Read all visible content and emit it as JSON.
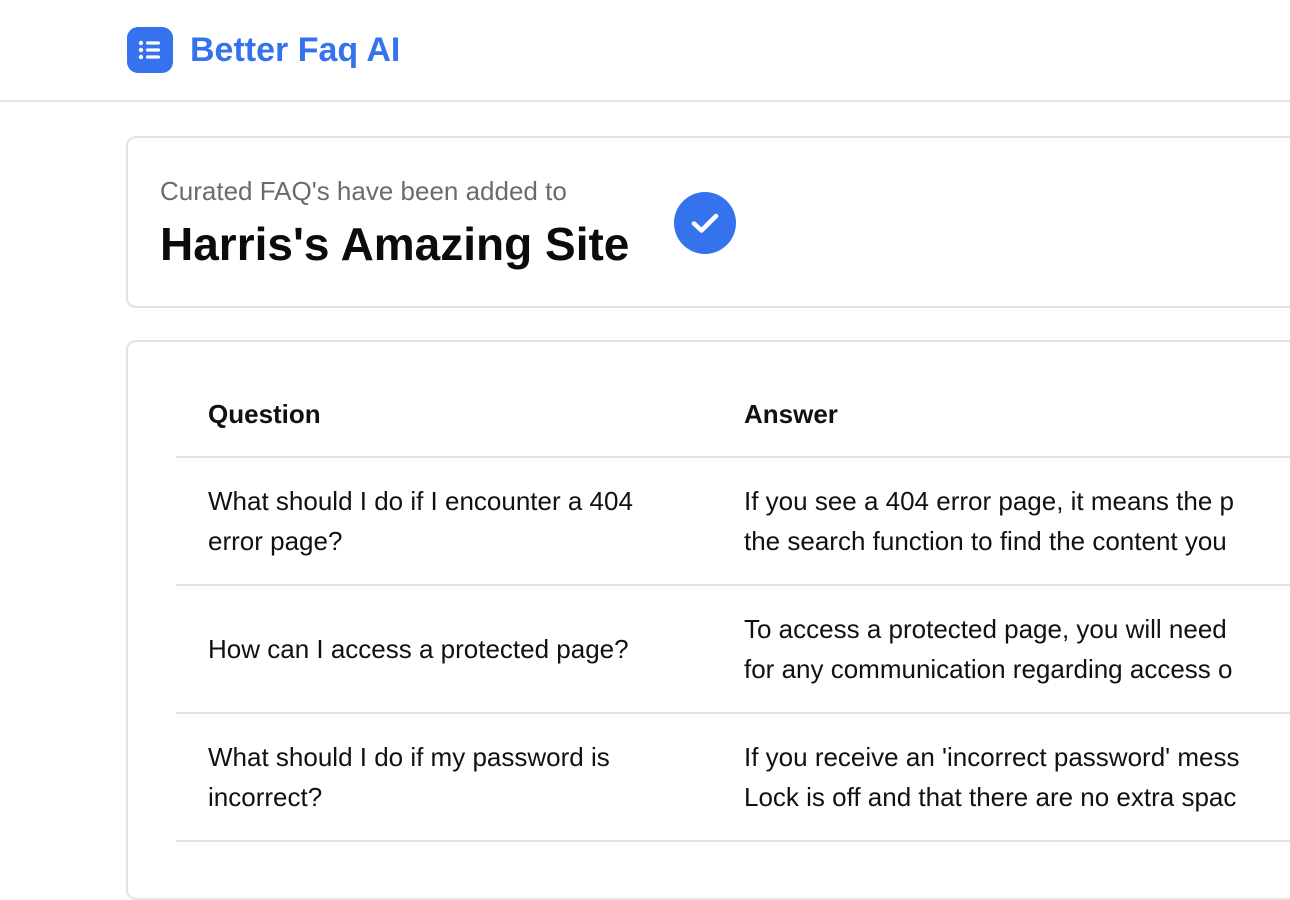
{
  "app": {
    "name": "Better Faq AI",
    "logo_icon": "list-icon",
    "accent_color": "#3472ee"
  },
  "status": {
    "caption": "Curated FAQ's have been added to",
    "site_name": "Harris's Amazing Site",
    "icon": "check-circle-icon"
  },
  "table": {
    "headers": {
      "question": "Question",
      "answer": "Answer"
    },
    "rows": [
      {
        "question": "What should I do if I encounter a 404 error page?",
        "answer_line1": "If you see a 404 error page, it means the p",
        "answer_line2": "the search function to find the content you"
      },
      {
        "question": "How can I access a protected page?",
        "answer_line1": "To access a protected page, you will need",
        "answer_line2": "for any communication regarding access o"
      },
      {
        "question": "What should I do if my password is incorrect?",
        "answer_line1": "If you receive an 'incorrect password' mess",
        "answer_line2": "Lock is off and that there are no extra spac"
      }
    ]
  }
}
